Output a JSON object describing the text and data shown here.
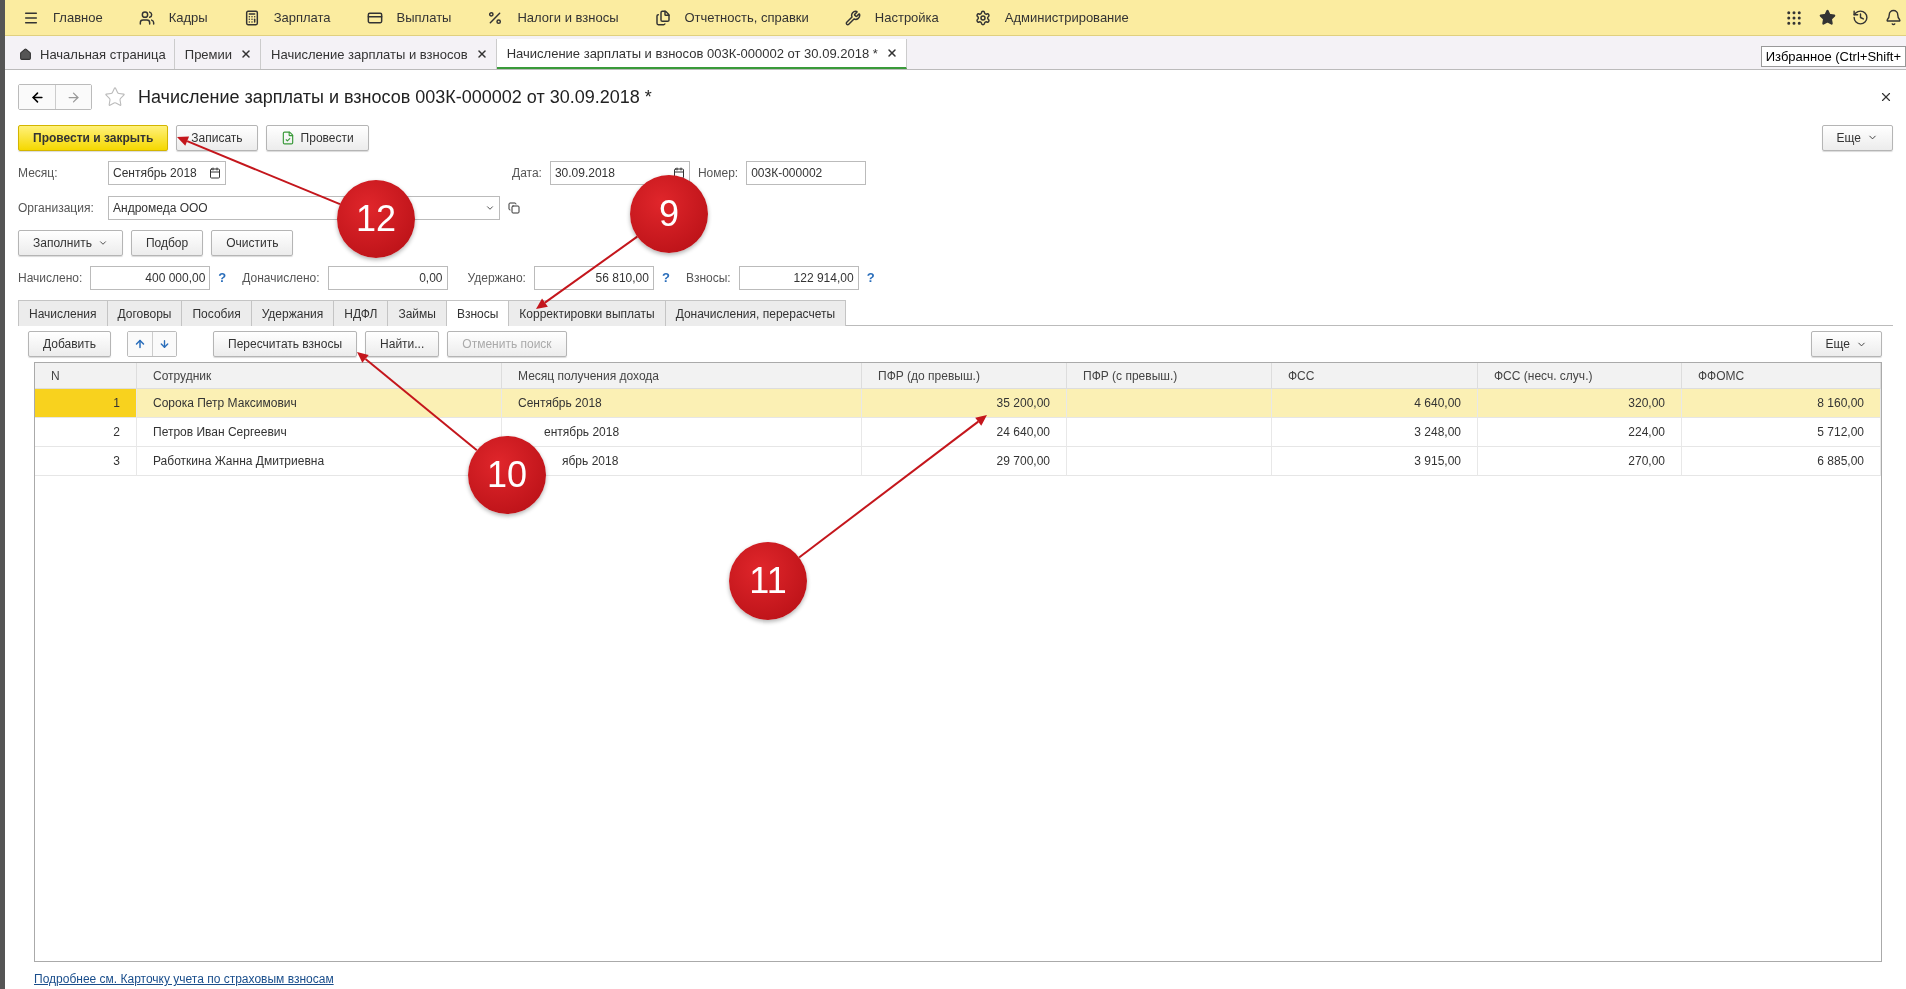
{
  "top_menu": [
    {
      "label": "Главное"
    },
    {
      "label": "Кадры"
    },
    {
      "label": "Зарплата"
    },
    {
      "label": "Выплаты"
    },
    {
      "label": "Налоги и взносы"
    },
    {
      "label": "Отчетность, справки"
    },
    {
      "label": "Настройка"
    },
    {
      "label": "Администрирование"
    }
  ],
  "open_tabs": [
    {
      "label": "Начальная страница",
      "closable": false,
      "selected": false
    },
    {
      "label": "Премии",
      "closable": true,
      "selected": false
    },
    {
      "label": "Начисление зарплаты и взносов",
      "closable": true,
      "selected": false
    },
    {
      "label": "Начисление зарплаты и взносов 003К-000002 от 30.09.2018 *",
      "closable": true,
      "selected": true
    }
  ],
  "tooltip": "Избранное (Ctrl+Shift+",
  "document": {
    "title": "Начисление зарплаты и взносов 003К-000002 от 30.09.2018 *",
    "favorite": false
  },
  "command_bar": {
    "buttons": [
      {
        "label": "Провести и закрыть",
        "kind": "primary"
      },
      {
        "label": "Записать",
        "kind": "plain"
      },
      {
        "label": "Провести",
        "kind": "post"
      }
    ],
    "more": "Еще"
  },
  "header": {
    "month": {
      "label": "Месяц:",
      "value": "Сентябрь 2018"
    },
    "date": {
      "label": "Дата:",
      "value": "30.09.2018"
    },
    "number": {
      "label": "Номер:",
      "value": "003К-000002"
    },
    "organization": {
      "label": "Организация:",
      "value": "Андромеда ООО"
    }
  },
  "fill_buttons": [
    {
      "label": "Заполнить",
      "dropdown": true
    },
    {
      "label": "Подбор",
      "dropdown": false
    },
    {
      "label": "Очистить",
      "dropdown": false
    }
  ],
  "totals": [
    {
      "label": "Начислено:",
      "value": "400 000,00",
      "help": "?"
    },
    {
      "label": "Доначислено:",
      "value": "0,00"
    },
    {
      "label": "Удержано:",
      "value": "56 810,00",
      "help": "?"
    },
    {
      "label": "Взносы:",
      "value": "122 914,00",
      "help": "?"
    }
  ],
  "section_tabs": [
    {
      "label": "Начисления",
      "selected": false
    },
    {
      "label": "Договоры",
      "selected": false
    },
    {
      "label": "Пособия",
      "selected": false
    },
    {
      "label": "Удержания",
      "selected": false
    },
    {
      "label": "НДФЛ",
      "selected": false
    },
    {
      "label": "Займы",
      "selected": false
    },
    {
      "label": "Взносы",
      "selected": true
    },
    {
      "label": "Корректировки выплаты",
      "selected": false
    },
    {
      "label": "Доначисления, перерасчеты",
      "selected": false
    }
  ],
  "table_toolbar": {
    "add": "Добавить",
    "buttons": [
      {
        "label": "Пересчитать взносы",
        "disabled": false
      },
      {
        "label": "Найти...",
        "disabled": false
      },
      {
        "label": "Отменить поиск",
        "disabled": true
      }
    ],
    "more": "Еще"
  },
  "table": {
    "columns": [
      "N",
      "Сотрудник",
      "Месяц получения дохода",
      "ПФР (до превыш.)",
      "ПФР (с превыш.)",
      "ФСС",
      "ФСС (несч. случ.)",
      "ФФОМС"
    ],
    "rows": [
      {
        "selected": true,
        "cells": [
          "1",
          "Сорока Петр Максимович",
          "Сентябрь 2018",
          "35 200,00",
          "",
          "4 640,00",
          "320,00",
          "8 160,00"
        ]
      },
      {
        "selected": false,
        "cells": [
          "2",
          "Петров Иван Сергеевич",
          "ентябрь 2018",
          "24 640,00",
          "",
          "3 248,00",
          "224,00",
          "5 712,00"
        ]
      },
      {
        "selected": false,
        "cells": [
          "3",
          "Работкина Жанна Дмитриевна",
          "ябрь 2018",
          "29 700,00",
          "",
          "3 915,00",
          "270,00",
          "6 885,00"
        ]
      }
    ]
  },
  "footer_link": "Подробнее см. Карточку учета по страховым взносам",
  "callouts": [
    {
      "number": "12"
    },
    {
      "number": "9"
    },
    {
      "number": "10"
    },
    {
      "number": "11"
    }
  ]
}
